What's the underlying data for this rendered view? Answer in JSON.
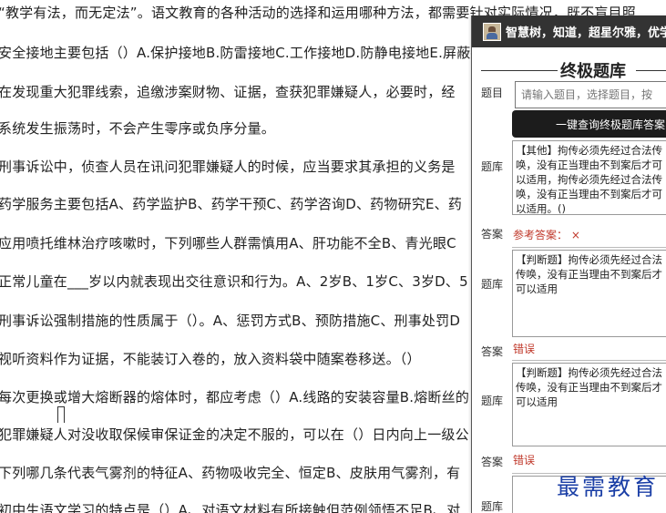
{
  "document": {
    "lines": [
      "“教学有法，而无定法”。语文教育的各种活动的选择和运用哪种方法，都需要针对实际情况，既不盲目照",
      "安全接地主要包括（）A.保护接地B.防雷接地C.工作接地D.防静电接地E.屏蔽接地",
      "在发现重大犯罪线索，追缴涉案财物、证据，查获犯罪嫌疑人，必要时，经",
      "系统发生振荡时，不会产生零序或负序分量。",
      "刑事诉讼中，侦查人员在讯问犯罪嫌疑人的时候，应当要求其承担的义务是",
      "药学服务主要包括A、药学监护B、药学干预C、药学咨询D、药物研究E、药",
      "应用喷托维林治疗咳嗽时，下列哪些人群需慎用A、肝功能不全B、青光眼C",
      "正常儿童在___岁以内就表现出交往意识和行为。A、2岁B、1岁C、3岁D、5",
      "刑事诉讼强制措施的性质属于（）。A、惩罚方式B、预防措施C、刑事处罚D",
      "视听资料作为证据，不能装订入卷的，放入资料袋中随案卷移送。（）",
      "每次更换或增大熔断器的熔体时，都应考虑（）A.线路的安装容量B.熔断丝的",
      "犯罪嫌疑人对没收取保候审保证金的决定不服的，可以在（）日内向上一级公",
      "下列哪几条代表气雾剂的特征A、药物吸收完全、恒定B、皮肤用气雾剂，有",
      "初中生语文学习的特点是（）A、对语文材料有所接触但范例领悟不足B、对"
    ]
  },
  "panel": {
    "header_text": "智慧树，知道，超星尔雅，优学院",
    "title": "终极题库",
    "labels": {
      "question": "题目",
      "bank": "题库",
      "answer": "答案"
    },
    "search_placeholder": "请输入题目，选择题目，按",
    "query_button": "一键查询终极题库答案",
    "results": [
      {
        "bank_text": "【其他】拘传必须先经过合法传唤，没有正当理由不到案后才可以适用，拘传必须先经过合法传唤，没有正当理由不到案后才可以适用。()",
        "answer_label": "参考答案：",
        "answer_value": "×"
      },
      {
        "bank_text": "【判断题】拘传必须先经过合法传唤，没有正当理由不到案后才可以适用",
        "answer_value": "错误"
      },
      {
        "bank_text": "【判断题】拘传必须先经过合法传唤，没有正当理由不到案后才可以适用",
        "answer_value": "错误"
      }
    ]
  },
  "watermark": "最需教育",
  "colors": {
    "header_bg": "#333333",
    "button_bg": "#1c1c1c",
    "answer_red": "#c0392b",
    "watermark_blue": "#1b3fa6"
  }
}
